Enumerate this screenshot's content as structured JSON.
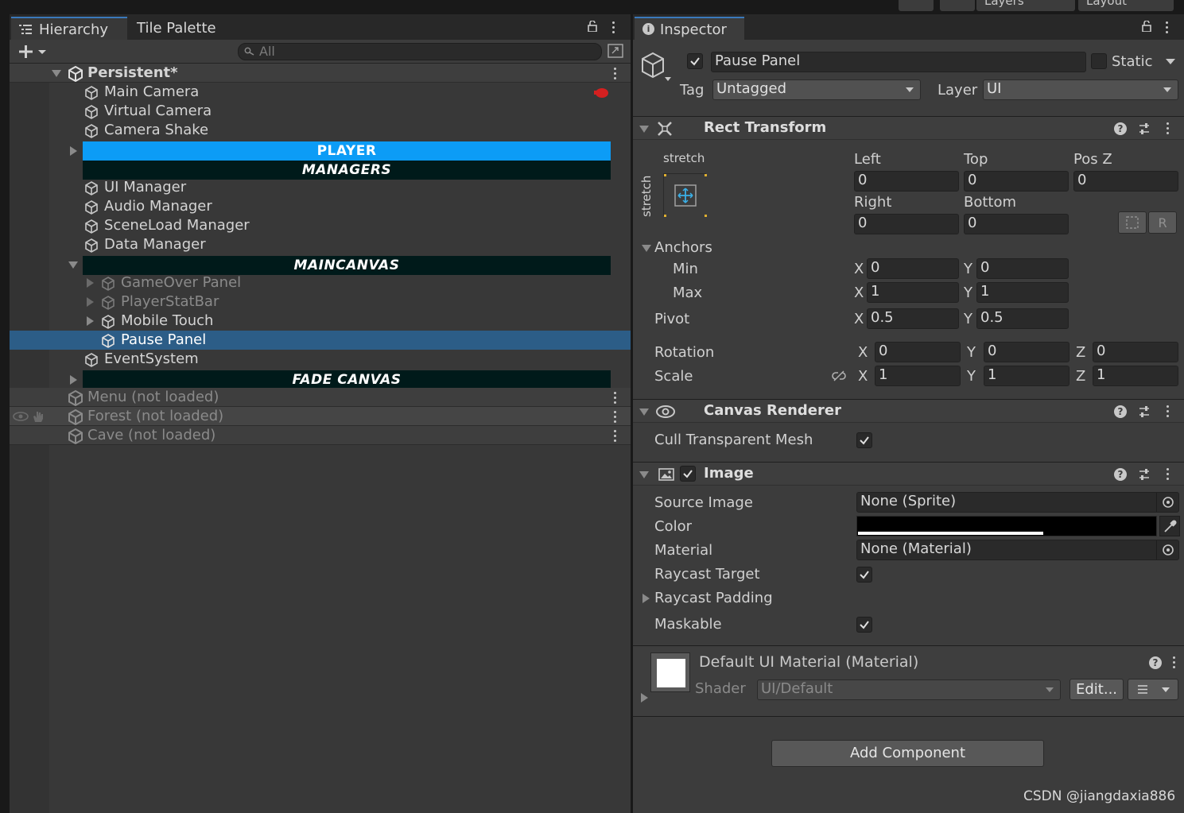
{
  "topbar": {
    "layers_label": "Layers",
    "layout_label": "Layout"
  },
  "hierarchy": {
    "tab_active": "Hierarchy",
    "tab_other": "Tile Palette",
    "search_placeholder": "All",
    "scene_root": "Persistent*",
    "items": [
      "Main Camera",
      "Virtual Camera",
      "Camera Shake",
      "PLAYER",
      "MANAGERS",
      "UI Manager",
      "Audio Manager",
      "SceneLoad Manager",
      "Data Manager",
      "MAINCANVAS",
      "GameOver Panel",
      "PlayerStatBar",
      "Mobile Touch",
      "Pause Panel",
      "EventSystem",
      "FADE CANVAS"
    ],
    "scenes_unloaded": [
      "Menu (not loaded)",
      "Forest (not loaded)",
      "Cave (not loaded)"
    ],
    "header_colors": {
      "player": "#0c9cf6",
      "dark": "#001a1a"
    }
  },
  "inspector": {
    "tab": "Inspector",
    "object_name": "Pause Panel",
    "static_label": "Static",
    "tag_label": "Tag",
    "tag_value": "Untagged",
    "layer_label": "Layer",
    "layer_value": "UI",
    "rect_transform": {
      "title": "Rect Transform",
      "stretch_h": "stretch",
      "stretch_v": "stretch",
      "left_label": "Left",
      "left": "0",
      "top_label": "Top",
      "top": "0",
      "posz_label": "Pos Z",
      "posz": "0",
      "right_label": "Right",
      "right": "0",
      "bottom_label": "Bottom",
      "bottom": "0",
      "r_button": "R",
      "anchors_label": "Anchors",
      "min_label": "Min",
      "min_x": "0",
      "min_y": "0",
      "max_label": "Max",
      "max_x": "1",
      "max_y": "1",
      "pivot_label": "Pivot",
      "pivot_x": "0.5",
      "pivot_y": "0.5",
      "rotation_label": "Rotation",
      "rot_x": "0",
      "rot_y": "0",
      "rot_z": "0",
      "scale_label": "Scale",
      "scale_x": "1",
      "scale_y": "1",
      "scale_z": "1",
      "x": "X",
      "y": "Y",
      "z": "Z"
    },
    "canvas_renderer": {
      "title": "Canvas Renderer",
      "cull_label": "Cull Transparent Mesh"
    },
    "image": {
      "title": "Image",
      "source_label": "Source Image",
      "source_value": "None (Sprite)",
      "color_label": "Color",
      "color_value": "#000000",
      "material_label": "Material",
      "material_value": "None (Material)",
      "raycast_target_label": "Raycast Target",
      "raycast_padding_label": "Raycast Padding",
      "maskable_label": "Maskable"
    },
    "material": {
      "title": "Default UI Material (Material)",
      "shader_label": "Shader",
      "shader_value": "UI/Default",
      "edit_button": "Edit..."
    },
    "add_component": "Add Component"
  },
  "watermark": "CSDN @jiangdaxia886"
}
